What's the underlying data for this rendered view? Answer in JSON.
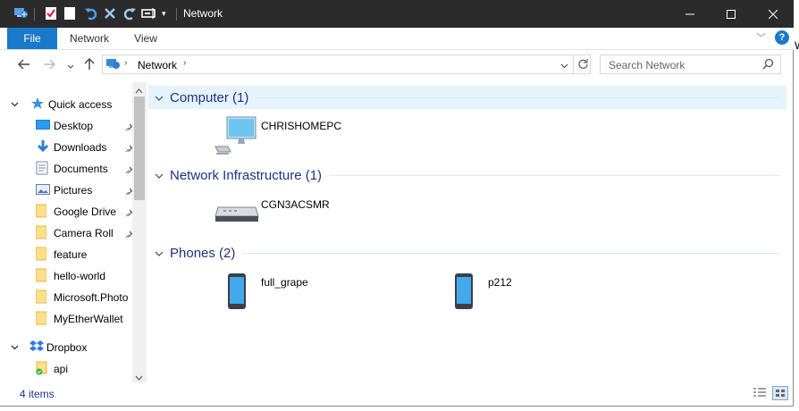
{
  "window": {
    "title": "Network"
  },
  "ribbon": {
    "tabs": [
      "File",
      "Network",
      "View"
    ]
  },
  "address": {
    "location": "Network"
  },
  "search": {
    "placeholder": "Search Network"
  },
  "sidebar": {
    "quick_access": "Quick access",
    "items": [
      {
        "label": "Desktop",
        "pinned": true
      },
      {
        "label": "Downloads",
        "pinned": true
      },
      {
        "label": "Documents",
        "pinned": true
      },
      {
        "label": "Pictures",
        "pinned": true
      },
      {
        "label": "Google Drive",
        "pinned": true
      },
      {
        "label": "Camera Roll",
        "pinned": true
      },
      {
        "label": "feature",
        "pinned": false
      },
      {
        "label": "hello-world",
        "pinned": false
      },
      {
        "label": "Microsoft.Photo",
        "pinned": false
      },
      {
        "label": "MyEtherWallet",
        "pinned": false
      }
    ],
    "dropbox": "Dropbox",
    "dropbox_child": "api"
  },
  "groups": [
    {
      "title": "Computer (1)",
      "items": [
        "CHRISHOMEPC"
      ]
    },
    {
      "title": "Network Infrastructure (1)",
      "items": [
        "CGN3ACSMR"
      ]
    },
    {
      "title": "Phones (2)",
      "items": [
        "full_grape",
        "p212"
      ]
    }
  ],
  "status": {
    "count": "4 items"
  },
  "overlap": {
    "char": "W"
  },
  "colors": {
    "accent": "#1979ca",
    "titlebar": "#2b2b2b",
    "group_header": "#1e3287"
  }
}
